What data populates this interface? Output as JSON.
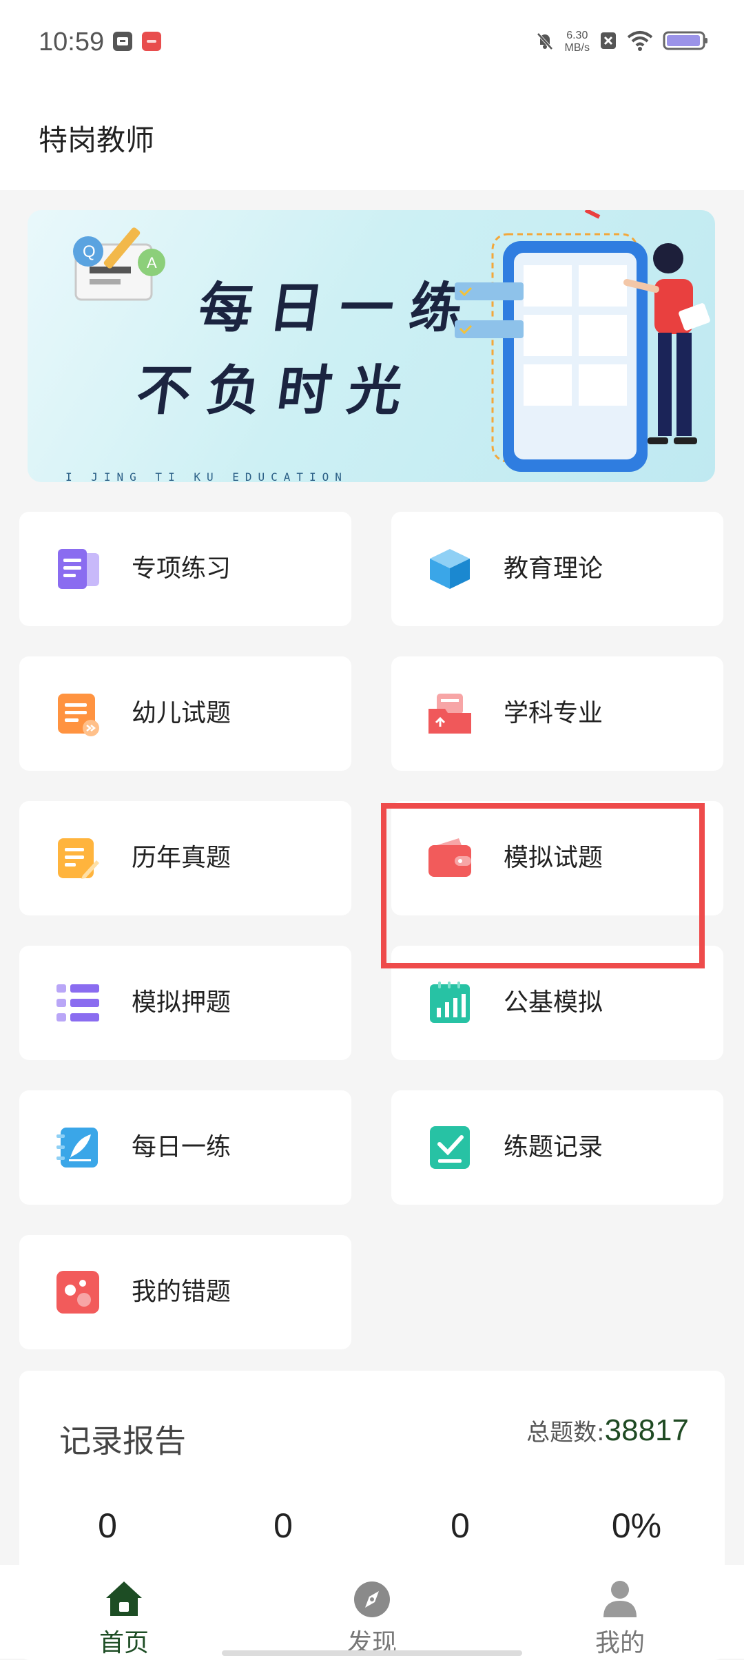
{
  "status_bar": {
    "time": "10:59",
    "net_speed_value": "6.30",
    "net_speed_unit": "MB/s"
  },
  "header": {
    "title": "特岗教师"
  },
  "banner": {
    "line1": "每日一练",
    "line2": "不负时光",
    "subtitle": "I JING TI KU EDUCATION"
  },
  "menu": [
    {
      "label": "专项练习",
      "icon": "document-icon",
      "color": "#8a6cf0"
    },
    {
      "label": "教育理论",
      "icon": "cube-icon",
      "color": "#3aa6e8"
    },
    {
      "label": "幼儿试题",
      "icon": "list-doc-icon",
      "color": "#ff9340"
    },
    {
      "label": "学科专业",
      "icon": "folder-upload-icon",
      "color": "#f0585a"
    },
    {
      "label": "历年真题",
      "icon": "edit-doc-icon",
      "color": "#ffb43d"
    },
    {
      "label": "模拟试题",
      "icon": "wallet-icon",
      "color": "#f25b5b"
    },
    {
      "label": "模拟押题",
      "icon": "list-icon",
      "color": "#8a6cf0"
    },
    {
      "label": "公基模拟",
      "icon": "bar-chart-icon",
      "color": "#27c2a4"
    },
    {
      "label": "每日一练",
      "icon": "feather-book-icon",
      "color": "#3aa6e8"
    },
    {
      "label": "练题记录",
      "icon": "checkbox-icon",
      "color": "#27c2a4"
    },
    {
      "label": "我的错题",
      "icon": "dots-icon",
      "color": "#f25b5b"
    }
  ],
  "report": {
    "title": "记录报告",
    "total_label": "总题数:",
    "total_value": "38817",
    "stats": [
      "0",
      "0",
      "0",
      "0%"
    ]
  },
  "tabs": [
    {
      "label": "首页",
      "icon": "home-icon",
      "active": true,
      "color": "#1d4d24"
    },
    {
      "label": "发现",
      "icon": "compass-icon",
      "active": false,
      "color": "#777777"
    },
    {
      "label": "我的",
      "icon": "person-icon",
      "active": false,
      "color": "#777777"
    }
  ]
}
